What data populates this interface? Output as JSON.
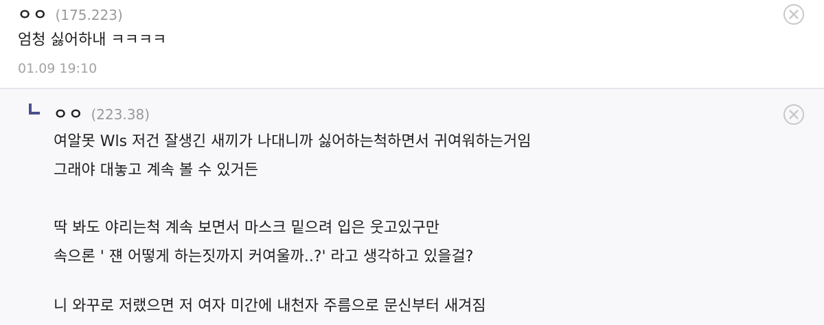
{
  "comment": {
    "nickname": "ㅇㅇ",
    "ip": "(175.223)",
    "text": "엄청 싫어하내 ㅋㅋㅋㅋ",
    "date": "01.09 19:10",
    "delete_icon": "circle-x-icon"
  },
  "reply": {
    "marker_icon": "reply-arrow-icon",
    "nickname": "ㅇㅇ",
    "ip": "(223.38)",
    "lines": [
      "여알못 Wls 저건 잘생긴 새끼가 나대니까 싫어하는척하면서 귀여워하는거임",
      "그래야 대놓고 계속 볼 수 있거든",
      "",
      "딱 봐도 야리는척 계속 보면서 마스크 밑으려 입은 웃고있구만",
      "속으론 ' 쟨 어떻게 하는짓까지 커여울까..?' 라고 생각하고 있을걸?",
      "",
      "니 와꾸로 저랬으면 저 여자 미간에 내천자 주름으로 문신부터 새겨짐"
    ],
    "delete_icon": "circle-x-icon"
  },
  "colors": {
    "reply_background": "#f8f8fb",
    "marker": "#4a4f8c",
    "ip_text": "#999999",
    "divider": "#e4e4ea"
  }
}
